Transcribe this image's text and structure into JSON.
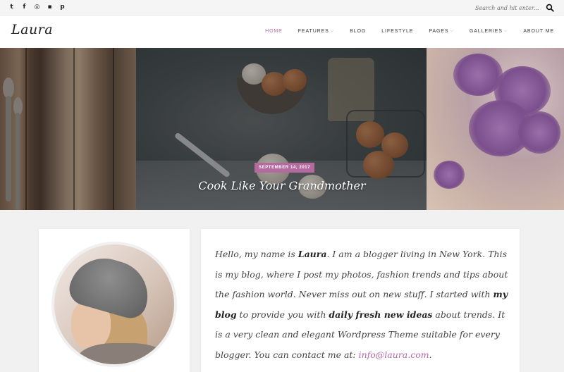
{
  "topbar": {
    "social": [
      {
        "name": "twitter-icon",
        "glyph": "t"
      },
      {
        "name": "facebook-icon",
        "glyph": "f"
      },
      {
        "name": "dribbble-icon",
        "glyph": "◎"
      },
      {
        "name": "flickr-icon",
        "glyph": "▪"
      },
      {
        "name": "pinterest-icon",
        "glyph": "p"
      }
    ],
    "search_placeholder": "Search and hit enter..."
  },
  "header": {
    "logo": "Laura",
    "nav": [
      {
        "label": "Home",
        "active": true,
        "dropdown": false
      },
      {
        "label": "Features",
        "active": false,
        "dropdown": true
      },
      {
        "label": "Blog",
        "active": false,
        "dropdown": false
      },
      {
        "label": "Lifestyle",
        "active": false,
        "dropdown": false
      },
      {
        "label": "Pages",
        "active": false,
        "dropdown": true
      },
      {
        "label": "Galleries",
        "active": false,
        "dropdown": true
      },
      {
        "label": "About Me",
        "active": false,
        "dropdown": false
      }
    ]
  },
  "hero": {
    "date": "September 14, 2017",
    "title": "Cook Like Your Grandmother"
  },
  "about": {
    "t1": "Hello, my name is ",
    "name": "Laura",
    "t2": ". I am a blogger living in New York. This is my blog, where I post my photos, fashion trends and tips about the fashion world. Never miss out on new stuff. I started with ",
    "b1": "my blog",
    "t3": " to provide you with ",
    "b2": "daily fresh new ideas",
    "t4": " about trends. It is a very clean and elegant Wordpress Theme suitable for every blogger. You can contact me at: ",
    "email": "info@laura.com",
    "t5": "."
  },
  "colors": {
    "accent": "#b268a6",
    "badge": "#b56a9f"
  }
}
